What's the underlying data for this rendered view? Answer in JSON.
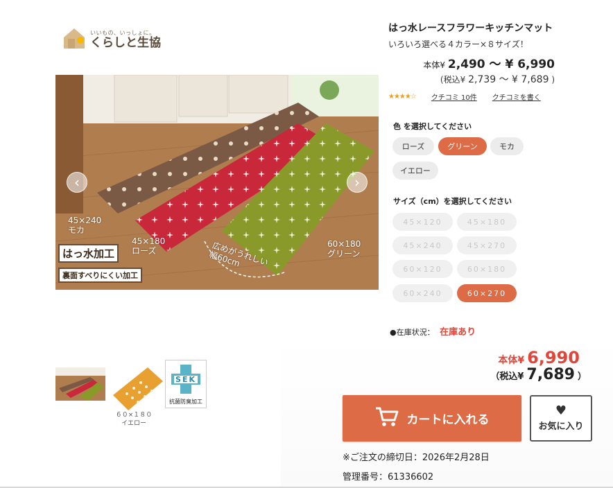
{
  "logo": {
    "tagline": "いいもの、いっしょに。",
    "name": "くらしと生協"
  },
  "product": {
    "title": "はっ水レースフラワーキッチンマット",
    "subtitle": "いろいろ選べる４カラー×８サイズ！",
    "price_label": "本体¥",
    "price_range": "2,490 ～ ¥ 6,990",
    "tax_label": "(税込¥",
    "tax_range": "2,739 ～ ¥ 7,689",
    "tax_close": ")",
    "stars": "★★★★☆",
    "review_link": "クチコミ 10件",
    "write_review_link": "クチコミを書く"
  },
  "image_labels": {
    "moca": "45×240\nモカ",
    "rose": "45×180\nローズ",
    "green": "60×180\nグリーン",
    "wide": "広めがうれしい\n幅60cm",
    "badge1": "はっ水加工",
    "badge2": "裏面すべりにくい加工"
  },
  "thumbnails": {
    "caption": "６０×１８０\nイエロー",
    "sek_text": "SEK",
    "sek_caption": "抗菌防臭加工"
  },
  "color_section": {
    "label": "色 を選択してください",
    "options": [
      "ローズ",
      "グリーン",
      "モカ",
      "イエロー"
    ],
    "selected": "グリーン"
  },
  "size_section": {
    "label": "サイズ（cm）を選択してください",
    "options": [
      "45×120",
      "45×180",
      "45×240",
      "45×270",
      "60×120",
      "60×180",
      "60×240",
      "60×270"
    ],
    "selected": "60×270"
  },
  "stock": {
    "label": "●在庫状況：",
    "value": "在庫あり"
  },
  "buy": {
    "price_label": "本体¥",
    "price": "6,990",
    "tax_open": "（税込¥",
    "tax_price": "7,689",
    "tax_close": "）",
    "cart_button": "カートに入れる",
    "fav_button": "お気に入り",
    "deadline": "※ご注文の締切日：2026年2月28日",
    "mgmt": "管理番号：61336602"
  },
  "colors": {
    "accent": "#dd6b45",
    "stock_red": "#e0463a",
    "rose": "#c8283a",
    "green": "#8a9a2a",
    "moca": "#7a5a44",
    "yellow": "#e8a030"
  }
}
